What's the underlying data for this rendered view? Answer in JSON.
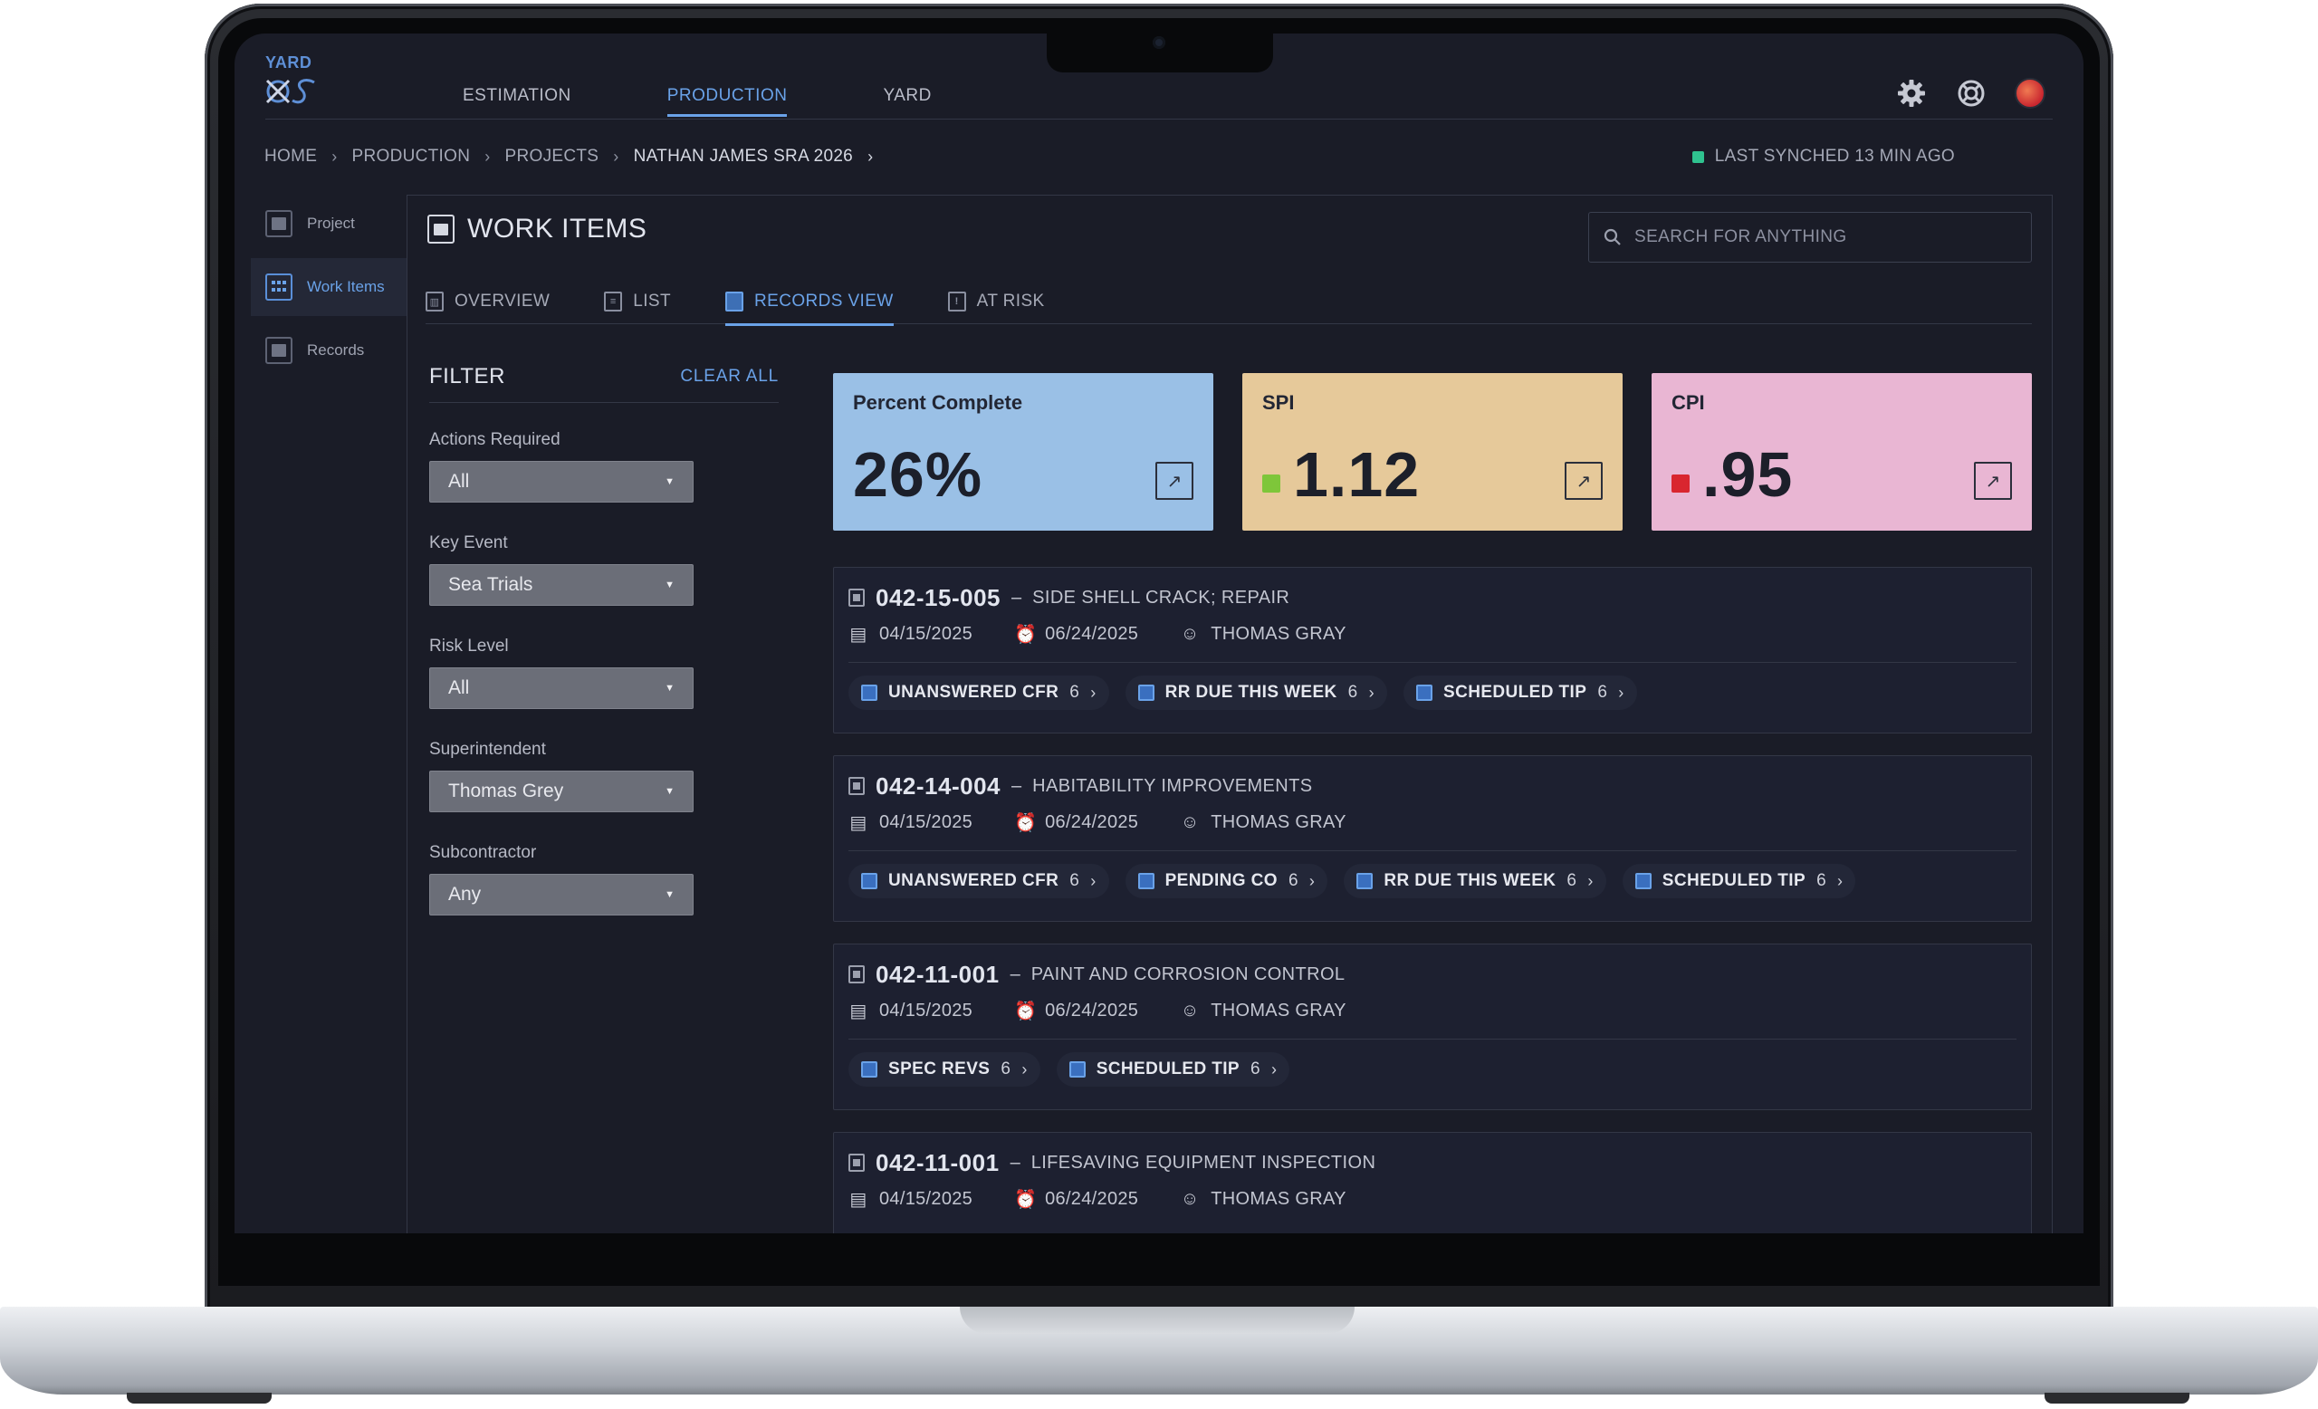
{
  "app": {
    "logo_text": "YARD",
    "nav_tabs": [
      {
        "label": "ESTIMATION",
        "active": false
      },
      {
        "label": "PRODUCTION",
        "active": true
      },
      {
        "label": "YARD",
        "active": false
      }
    ],
    "icons": [
      "gear-icon",
      "help-lifebuoy-icon",
      "user-avatar"
    ]
  },
  "breadcrumb": [
    "HOME",
    "PRODUCTION",
    "PROJECTS",
    "NATHAN JAMES SRA 2026"
  ],
  "sync_status": "LAST SYNCHED 13 MIN AGO",
  "sidebar": {
    "items": [
      {
        "label": "Project",
        "active": false
      },
      {
        "label": "Work Items",
        "active": true
      },
      {
        "label": "Records",
        "active": false
      }
    ]
  },
  "page": {
    "title": "WORK ITEMS",
    "search_placeholder": "SEARCH FOR ANYTHING",
    "subtabs": [
      {
        "label": "OVERVIEW",
        "active": false
      },
      {
        "label": "LIST",
        "active": false
      },
      {
        "label": "RECORDS VIEW",
        "active": true
      },
      {
        "label": "AT RISK",
        "active": false
      }
    ]
  },
  "filter": {
    "title": "FILTER",
    "clear_label": "CLEAR ALL",
    "fields": [
      {
        "label": "Actions Required",
        "value": "All"
      },
      {
        "label": "Key Event",
        "value": "Sea Trials"
      },
      {
        "label": "Risk Level",
        "value": "All"
      },
      {
        "label": "Superintendent",
        "value": "Thomas Grey"
      },
      {
        "label": "Subcontractor",
        "value": "Any"
      }
    ]
  },
  "kpis": [
    {
      "label": "Percent Complete",
      "value": "26%",
      "color": "#9ac0e6",
      "indicator": null
    },
    {
      "label": "SPI",
      "value": "1.12",
      "color": "#e6c99a",
      "indicator": "#7ec63a"
    },
    {
      "label": "CPI",
      "value": ".95",
      "color": "#e9b6d3",
      "indicator": "#d9262f"
    }
  ],
  "work_items": [
    {
      "id": "042-15-005",
      "dash": "–",
      "title": "SIDE SHELL CRACK; REPAIR",
      "start": "04/15/2025",
      "due": "06/24/2025",
      "owner": "THOMAS GRAY",
      "chips": [
        {
          "label": "UNANSWERED CFR",
          "count": "6"
        },
        {
          "label": "RR DUE THIS WEEK",
          "count": "6"
        },
        {
          "label": "SCHEDULED TIP",
          "count": "6"
        }
      ]
    },
    {
      "id": "042-14-004",
      "dash": "–",
      "title": "HABITABILITY IMPROVEMENTS",
      "start": "04/15/2025",
      "due": "06/24/2025",
      "owner": "THOMAS GRAY",
      "chips": [
        {
          "label": "UNANSWERED CFR",
          "count": "6"
        },
        {
          "label": "PENDING CO",
          "count": "6"
        },
        {
          "label": "RR DUE THIS WEEK",
          "count": "6"
        },
        {
          "label": "SCHEDULED TIP",
          "count": "6"
        }
      ]
    },
    {
      "id": "042-11-001",
      "dash": "–",
      "title": "PAINT AND CORROSION CONTROL",
      "start": "04/15/2025",
      "due": "06/24/2025",
      "owner": "THOMAS GRAY",
      "chips": [
        {
          "label": "SPEC REVS",
          "count": "6"
        },
        {
          "label": "SCHEDULED TIP",
          "count": "6"
        }
      ]
    },
    {
      "id": "042-11-001",
      "dash": "–",
      "title": "LIFESAVING EQUIPMENT INSPECTION",
      "start": "04/15/2025",
      "due": "06/24/2025",
      "owner": "THOMAS GRAY",
      "chips": []
    }
  ]
}
